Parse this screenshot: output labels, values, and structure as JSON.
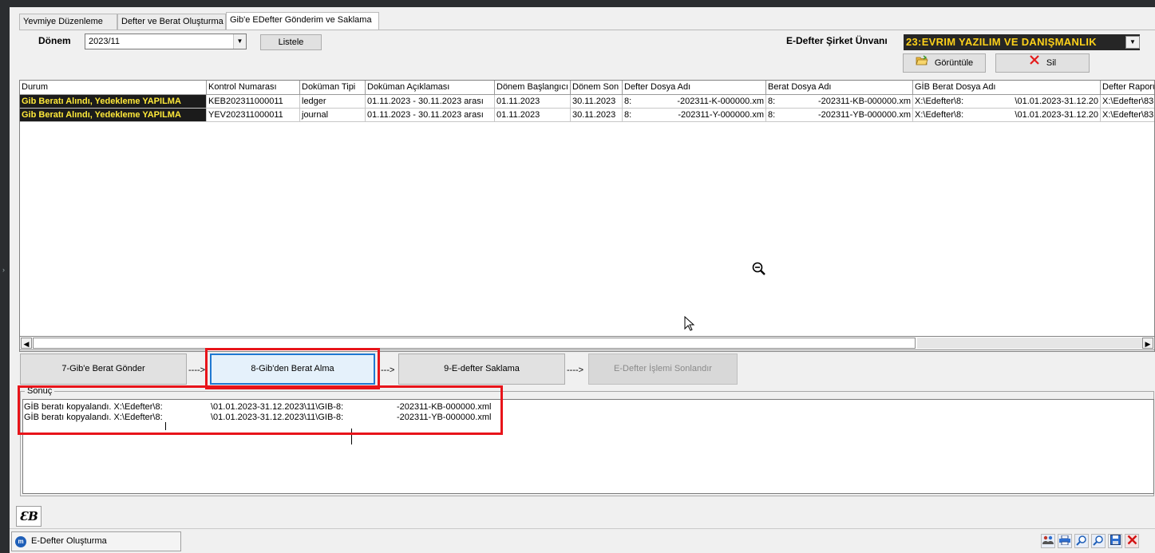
{
  "tabs": [
    {
      "label": "Yevmiye Düzenleme"
    },
    {
      "label": "Defter ve Berat Oluşturma"
    },
    {
      "label": "Gib'e EDefter Gönderim ve Saklama",
      "active": true
    }
  ],
  "filter": {
    "period_label": "Dönem",
    "period_value": "2023/11",
    "list_button": "Listele",
    "company_label": "E-Defter Şirket Ünvanı",
    "company_value": "23:EVRIM YAZILIM VE DANIŞMANLIK",
    "view_button": "Görüntüle",
    "delete_button": "Sil"
  },
  "grid": {
    "columns": [
      "Durum",
      "Kontrol Numarası",
      "Doküman Tipi",
      "Doküman Açıklaması",
      "Dönem Başlangıcı",
      "Dönem Son",
      "Defter Dosya Adı",
      "Berat Dosya Adı",
      "GİB Berat Dosya Adı",
      "Defter Raporu"
    ],
    "rows": [
      {
        "status": "Gib Beratı Alındı, Yedekleme YAPILMA",
        "control_no": "KEB202311000011",
        "doc_type": "ledger",
        "doc_desc": "01.11.2023 - 30.11.2023 arası",
        "start": "01.11.2023",
        "end": "30.11.2023",
        "ledger_prefix": "8:",
        "ledger_file": "-202311-K-000000.xm",
        "berat_prefix": "8:",
        "berat_file": "-202311-KB-000000.xm",
        "gib_prefix": "X:\\Edefter\\8:",
        "gib_file": "\\01.01.2023-31.12.20",
        "report": "X:\\Edefter\\83"
      },
      {
        "status": "Gib Beratı Alındı, Yedekleme YAPILMA",
        "control_no": "YEV202311000011",
        "doc_type": "journal",
        "doc_desc": "01.11.2023 - 30.11.2023 arası",
        "start": "01.11.2023",
        "end": "30.11.2023",
        "ledger_prefix": "8:",
        "ledger_file": "-202311-Y-000000.xm",
        "berat_prefix": "8:",
        "berat_file": "-202311-YB-000000.xm",
        "gib_prefix": "X:\\Edefter\\8:",
        "gib_file": "\\01.01.2023-31.12.20",
        "report": "X:\\Edefter\\83"
      }
    ]
  },
  "steps": [
    {
      "label": "7-Gib'e Berat Gönder"
    },
    {
      "label": "8-Gib'den Berat Alma"
    },
    {
      "label": "9-E-defter Saklama"
    },
    {
      "label": "E-Defter İşlemi Sonlandır"
    }
  ],
  "step_arrows": [
    "---->",
    "--->",
    "---->"
  ],
  "result": {
    "title": "Sonuç",
    "lines": [
      {
        "a": "GİB beratı kopyalandı. X:\\Edefter\\8:",
        "b": "\\01.01.2023-31.12.2023\\11\\GIB-8:",
        "c": "-202311-KB-000000.xml"
      },
      {
        "a": "GİB beratı kopyalandı. X:\\Edefter\\8:",
        "b": "\\01.01.2023-31.12.2023\\11\\GIB-8:",
        "c": "-202311-YB-000000.xml"
      }
    ]
  },
  "logo": "ƐB",
  "taskbar": {
    "item": "E-Defter Oluşturma"
  },
  "colors": {
    "status_bg": "#1b1b1b",
    "status_text": "#ffe93a",
    "highlight": "#e8141a",
    "company_text": "#ffd21a"
  }
}
